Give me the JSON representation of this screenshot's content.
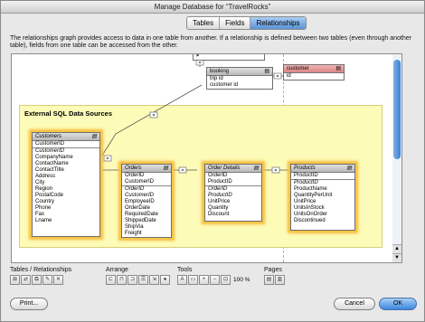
{
  "window": {
    "title": "Manage Database for “TravelRocks”"
  },
  "tabs": [
    {
      "label": "Tables"
    },
    {
      "label": "Fields"
    },
    {
      "label": "Relationships"
    }
  ],
  "active_tab": "Relationships",
  "description": "The relationships graph provides access to data in one table from another. If a relationship is defined between two tables (even through another table), fields from one table can be accessed from the other.",
  "group": {
    "title": "External SQL Data Sources",
    "color": "#fdfbb8"
  },
  "occurrences": {
    "top_partial": {
      "fields": [
        "≠"
      ]
    },
    "booking": {
      "name": "booking",
      "fields": [
        "trip id",
        "customer id"
      ]
    },
    "customer": {
      "name": "customer",
      "fields": [
        "id"
      ],
      "color": "#d98585"
    },
    "customers": {
      "name": "Customers",
      "key": "CustomerID",
      "fields": [
        "CustomerID",
        "CompanyName",
        "ContactName",
        "ContactTitle",
        "Address",
        "City",
        "Region",
        "PostalCode",
        "Country",
        "Phone",
        "Fax",
        "Lname"
      ]
    },
    "orders": {
      "name": "Orders",
      "keys": [
        "OrderID",
        "CustomerID"
      ],
      "fields": [
        "OrderID",
        "CustomerID",
        "EmployeeID",
        "OrderDate",
        "RequiredDate",
        "ShippedDate",
        "ShipVia",
        "Freight"
      ]
    },
    "order_details": {
      "name": "Order Details",
      "keys": [
        "OrderID",
        "ProductID"
      ],
      "fields": [
        "OrderID",
        "ProductID",
        "UnitPrice",
        "Quantity",
        "Discount"
      ]
    },
    "products": {
      "name": "Products",
      "key": "ProductID",
      "fields": [
        "ProductID",
        "ProductName",
        "QuantityPerUnit",
        "UnitPrice",
        "UnitsInStock",
        "UnitsOnOrder",
        "Discontinued"
      ]
    }
  },
  "relationship_operator": "=",
  "toolbar": {
    "tables_label": "Tables / Relationships",
    "arrange_label": "Arrange",
    "tools_label": "Tools",
    "pages_label": "Pages",
    "zoom": "100",
    "zoom_unit": "%"
  },
  "buttons": {
    "print": "Print...",
    "cancel": "Cancel",
    "ok": "OK"
  },
  "colors": {
    "selection_glow": "#f4b83c",
    "accent": "#3b86e0"
  }
}
